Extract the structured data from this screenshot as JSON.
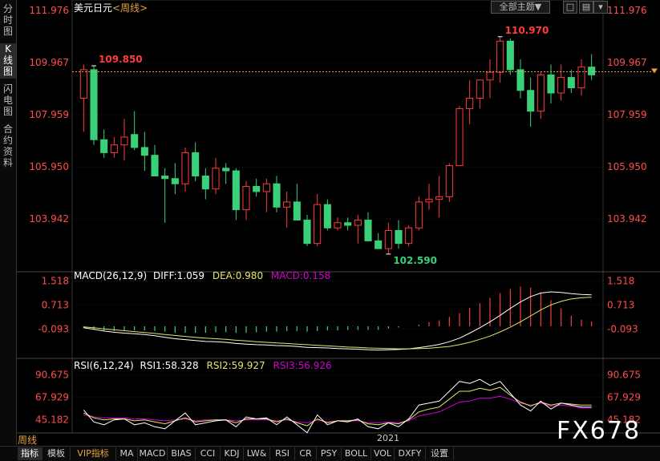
{
  "title": {
    "symbol": "美元日元",
    "period": "<周线>"
  },
  "left_tabs": [
    {
      "label": "分时图",
      "active": false
    },
    {
      "label": "K线图",
      "active": true
    },
    {
      "label": "闪电图",
      "active": false
    },
    {
      "label": "合约资料",
      "active": false
    }
  ],
  "toolbar": {
    "theme_label": "全部主题▼",
    "icon1": "□",
    "icon2": "▤",
    "icon3": "▾"
  },
  "colors": {
    "up": "#ff3b3b",
    "down": "#3ad07a",
    "dif": "#ffffff",
    "dea": "#e6e46a",
    "macd": "#d000d0",
    "rsi1": "#ffffff",
    "rsi2": "#e6e46a",
    "rsi3": "#d000d0",
    "price_line": "#e8a33b"
  },
  "chart_data": [
    {
      "type": "candlestick",
      "name": "美元日元<周线>",
      "ylim": [
        102.0,
        112.2
      ],
      "yticks": [
        111.976,
        109.967,
        107.959,
        105.95,
        103.942
      ],
      "ytick_labels": [
        "111.976",
        "109.967",
        "107.959",
        "105.950",
        "103.942"
      ],
      "current_price": 109.62,
      "annotations": [
        {
          "label": "109.850",
          "index": 1,
          "value": 109.85,
          "kind": "high"
        },
        {
          "label": "110.970",
          "index": 41,
          "value": 110.97,
          "kind": "high"
        },
        {
          "label": "102.590",
          "index": 30,
          "value": 102.59,
          "kind": "low"
        }
      ],
      "ohlc": [
        [
          108.6,
          109.9,
          107.3,
          109.7
        ],
        [
          109.7,
          109.85,
          106.8,
          107.0
        ],
        [
          107.0,
          107.4,
          106.3,
          106.5
        ],
        [
          106.5,
          107.1,
          106.3,
          106.8
        ],
        [
          106.8,
          107.8,
          106.2,
          107.1
        ],
        [
          107.2,
          108.1,
          106.6,
          106.7
        ],
        [
          106.7,
          107.3,
          105.8,
          106.4
        ],
        [
          106.4,
          106.8,
          105.6,
          105.6
        ],
        [
          105.6,
          105.9,
          103.8,
          105.5
        ],
        [
          105.5,
          106.1,
          104.9,
          105.3
        ],
        [
          105.3,
          106.7,
          105.0,
          106.5
        ],
        [
          106.5,
          106.9,
          105.4,
          105.6
        ],
        [
          105.6,
          105.9,
          104.7,
          105.1
        ],
        [
          105.1,
          106.3,
          104.9,
          105.9
        ],
        [
          105.9,
          106.1,
          105.3,
          105.8
        ],
        [
          105.8,
          105.9,
          103.9,
          104.3
        ],
        [
          104.3,
          105.4,
          103.9,
          105.2
        ],
        [
          105.2,
          105.5,
          104.8,
          105.0
        ],
        [
          105.0,
          105.5,
          104.2,
          105.3
        ],
        [
          105.3,
          105.6,
          104.2,
          104.4
        ],
        [
          104.4,
          105.0,
          103.6,
          104.6
        ],
        [
          104.6,
          105.3,
          103.9,
          103.9
        ],
        [
          103.9,
          104.1,
          102.9,
          103.0
        ],
        [
          103.0,
          104.9,
          102.9,
          104.5
        ],
        [
          104.5,
          104.7,
          103.5,
          103.6
        ],
        [
          103.6,
          104.0,
          103.5,
          103.8
        ],
        [
          103.8,
          104.0,
          103.5,
          103.7
        ],
        [
          103.7,
          104.1,
          103.0,
          103.9
        ],
        [
          103.9,
          104.2,
          103.2,
          103.1
        ],
        [
          103.1,
          103.4,
          102.8,
          102.8
        ],
        [
          102.8,
          103.8,
          102.59,
          103.5
        ],
        [
          103.5,
          103.9,
          102.8,
          103.0
        ],
        [
          103.0,
          103.7,
          102.9,
          103.6
        ],
        [
          103.6,
          104.8,
          103.5,
          104.6
        ],
        [
          104.6,
          105.3,
          104.3,
          104.7
        ],
        [
          104.7,
          105.6,
          104.0,
          104.8
        ],
        [
          104.8,
          106.1,
          104.6,
          106.0
        ],
        [
          106.0,
          108.3,
          106.0,
          108.2
        ],
        [
          108.2,
          109.3,
          107.6,
          108.6
        ],
        [
          108.6,
          109.3,
          108.2,
          109.3
        ],
        [
          109.3,
          110.1,
          108.6,
          109.6
        ],
        [
          109.6,
          110.97,
          109.2,
          110.8
        ],
        [
          110.8,
          110.9,
          109.5,
          109.7
        ],
        [
          109.7,
          110.1,
          108.6,
          108.9
        ],
        [
          108.9,
          109.4,
          107.5,
          108.1
        ],
        [
          108.1,
          109.6,
          107.8,
          109.5
        ],
        [
          109.5,
          109.9,
          108.4,
          108.8
        ],
        [
          108.8,
          109.9,
          108.5,
          109.4
        ],
        [
          109.4,
          109.7,
          108.8,
          109.0
        ],
        [
          109.0,
          110.1,
          108.7,
          109.8
        ],
        [
          109.8,
          110.3,
          109.3,
          109.5
        ]
      ]
    },
    {
      "type": "bar+line",
      "name": "MACD",
      "params": "MACD(26,12,9)",
      "dif_label": "DIFF:1.059",
      "dea_label": "DEA:0.980",
      "macd_label": "MACD:0.158",
      "ylim": [
        -1.0,
        1.7
      ],
      "yticks": [
        1.518,
        0.713,
        -0.093
      ],
      "ytick_labels": [
        "1.518",
        "0.713",
        "-0.093"
      ],
      "dif": [
        -0.05,
        -0.1,
        -0.16,
        -0.2,
        -0.23,
        -0.25,
        -0.28,
        -0.32,
        -0.37,
        -0.42,
        -0.45,
        -0.48,
        -0.51,
        -0.52,
        -0.54,
        -0.58,
        -0.6,
        -0.62,
        -0.63,
        -0.65,
        -0.66,
        -0.68,
        -0.71,
        -0.72,
        -0.73,
        -0.75,
        -0.76,
        -0.77,
        -0.79,
        -0.8,
        -0.79,
        -0.78,
        -0.76,
        -0.72,
        -0.67,
        -0.61,
        -0.52,
        -0.4,
        -0.23,
        -0.05,
        0.15,
        0.37,
        0.6,
        0.82,
        1.0,
        1.12,
        1.16,
        1.14,
        1.1,
        1.07,
        1.06
      ],
      "dea": [
        -0.02,
        -0.05,
        -0.09,
        -0.12,
        -0.15,
        -0.18,
        -0.21,
        -0.24,
        -0.28,
        -0.31,
        -0.34,
        -0.37,
        -0.4,
        -0.42,
        -0.44,
        -0.47,
        -0.49,
        -0.52,
        -0.54,
        -0.56,
        -0.58,
        -0.6,
        -0.62,
        -0.64,
        -0.66,
        -0.68,
        -0.7,
        -0.71,
        -0.73,
        -0.74,
        -0.75,
        -0.76,
        -0.76,
        -0.75,
        -0.74,
        -0.71,
        -0.68,
        -0.62,
        -0.54,
        -0.44,
        -0.33,
        -0.19,
        -0.03,
        0.15,
        0.35,
        0.55,
        0.72,
        0.84,
        0.92,
        0.96,
        0.98
      ],
      "macd": [
        -0.06,
        -0.1,
        -0.14,
        -0.16,
        -0.16,
        -0.14,
        -0.14,
        -0.16,
        -0.18,
        -0.22,
        -0.22,
        -0.22,
        -0.22,
        -0.2,
        -0.2,
        -0.22,
        -0.22,
        -0.2,
        -0.18,
        -0.18,
        -0.16,
        -0.16,
        -0.18,
        -0.16,
        -0.14,
        -0.14,
        -0.12,
        -0.12,
        -0.12,
        -0.12,
        -0.08,
        -0.04,
        0.0,
        0.06,
        0.14,
        0.2,
        0.32,
        0.44,
        0.62,
        0.78,
        0.96,
        1.12,
        1.26,
        1.34,
        1.3,
        1.14,
        0.88,
        0.6,
        0.36,
        0.22,
        0.16
      ]
    },
    {
      "type": "line",
      "name": "RSI",
      "params": "RSI(6,12,24)",
      "rsi1_label": "RSI1:58.328",
      "rsi2_label": "RSI2:59.927",
      "rsi3_label": "RSI3:56.926",
      "ylim": [
        35,
        100
      ],
      "yticks": [
        90.675,
        67.929,
        45.182
      ],
      "ytick_labels": [
        "90.675",
        "67.929",
        "45.182"
      ],
      "rsi1": [
        55,
        43,
        40,
        45,
        46,
        40,
        42,
        38,
        36,
        44,
        52,
        40,
        42,
        44,
        45,
        38,
        48,
        46,
        47,
        40,
        48,
        40,
        32,
        50,
        40,
        44,
        43,
        46,
        38,
        36,
        42,
        38,
        46,
        60,
        62,
        64,
        74,
        84,
        82,
        86,
        80,
        84,
        72,
        60,
        54,
        64,
        56,
        62,
        60,
        58,
        58
      ],
      "rsi2": [
        52,
        47,
        45,
        46,
        46,
        44,
        45,
        43,
        41,
        44,
        47,
        43,
        44,
        45,
        45,
        42,
        46,
        46,
        46,
        43,
        46,
        42,
        39,
        46,
        42,
        44,
        44,
        45,
        41,
        40,
        42,
        41,
        45,
        53,
        56,
        58,
        66,
        74,
        74,
        77,
        75,
        78,
        70,
        63,
        59,
        63,
        60,
        62,
        61,
        60,
        60
      ],
      "rsi3": [
        50,
        48,
        47,
        47,
        47,
        46,
        46,
        45,
        44,
        45,
        46,
        44,
        45,
        45,
        45,
        44,
        45,
        45,
        45,
        44,
        45,
        43,
        42,
        45,
        43,
        44,
        44,
        44,
        42,
        42,
        43,
        42,
        44,
        49,
        51,
        53,
        58,
        63,
        64,
        67,
        67,
        69,
        66,
        62,
        60,
        62,
        59,
        60,
        59,
        57,
        57
      ]
    }
  ],
  "x_axis": {
    "period_tag": "周线",
    "year_label": "2021"
  },
  "bottom_tabs": [
    "指标",
    "模板",
    "VIP指标",
    "MA",
    "MACD",
    "BIAS",
    "CCI",
    "KDJ",
    "LW&",
    "RSI",
    "CR",
    "PSY",
    "BOLL",
    "VOL",
    "DXFY",
    "设置"
  ],
  "watermark": "FX678"
}
